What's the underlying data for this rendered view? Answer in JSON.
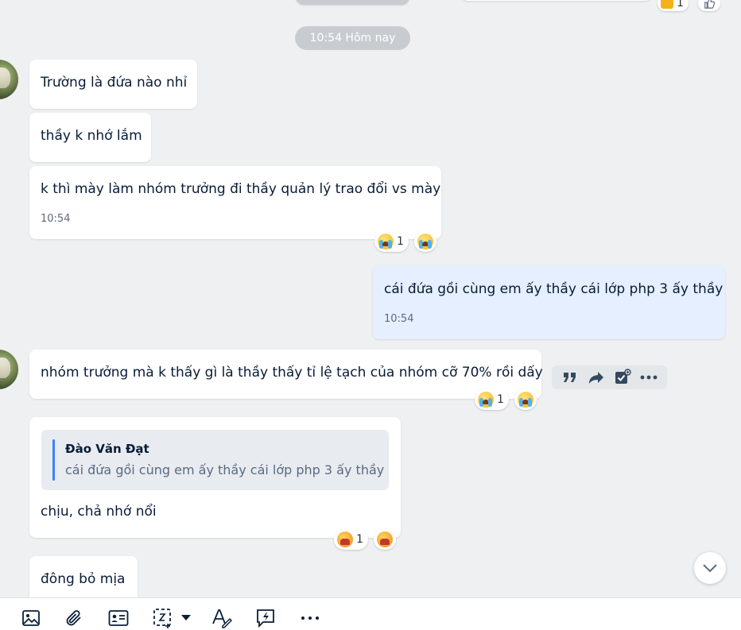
{
  "time_separator": "10:54 Hôm nay",
  "top_reaction": {
    "count": "1"
  },
  "messages": [
    {
      "text": "Trường là đứa nào nhỉ"
    },
    {
      "text": "thầy k nhớ lắm"
    },
    {
      "text": "k thì mày làm nhóm trưởng đi thầy quản lý trao đổi vs mày",
      "time": "10:54",
      "reaction_count": "1"
    },
    {
      "text": "cái đứa gồi cùng em ấy thầy cái lớp php 3 ấy thầy",
      "time": "10:54"
    },
    {
      "text": "nhóm trưởng mà k thấy gì là thầy thấy tỉ lệ tạch của nhóm cỡ 70% rồi dấy",
      "reaction_count": "1"
    },
    {
      "text": "chịu, chả nhớ nổi",
      "reaction_count": "1",
      "quote": {
        "author": "Đào Văn Đạt",
        "text": "cái đứa gồi cùng em ấy thầy cái lớp php 3 ấy thầy"
      }
    },
    {
      "text": "đông bỏ mịa"
    }
  ],
  "icons": {
    "hover_actions": [
      "quote-icon",
      "share-icon",
      "add-task-icon",
      "more-icon"
    ],
    "toolbar": [
      "image-icon",
      "attachment-icon",
      "contact-card-icon",
      "screenshot-icon",
      "dropdown-icon",
      "text-format-icon",
      "quick-message-icon",
      "more-icon"
    ]
  },
  "colors": {
    "accent": "#3b82f6",
    "my_bubble": "#e5efff",
    "background": "#eef0f1"
  }
}
